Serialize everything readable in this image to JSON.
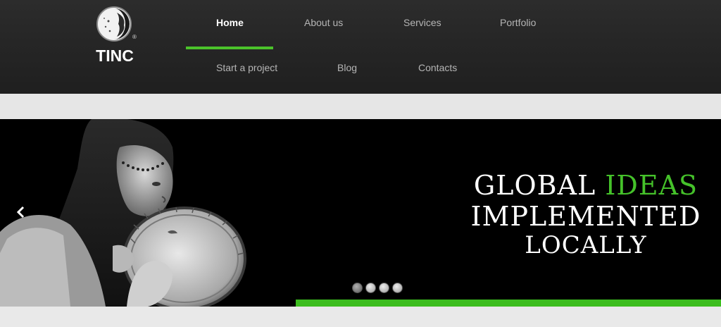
{
  "brand": {
    "name": "TINC",
    "reg_mark": "®"
  },
  "nav": {
    "items": [
      {
        "label": "Home",
        "active": true
      },
      {
        "label": "About us"
      },
      {
        "label": "Services"
      },
      {
        "label": "Portfolio"
      },
      {
        "label": "Start a project"
      },
      {
        "label": "Blog"
      },
      {
        "label": "Contacts"
      }
    ]
  },
  "slider": {
    "headline": {
      "line1_white": "GLOBAL ",
      "line1_green": "IDEAS",
      "line2": "IMPLEMENTED",
      "line3": "LOCALLY"
    },
    "prev_icon": "chevron-left-icon",
    "dots_count": 4,
    "active_dot": 0
  },
  "colors": {
    "accent_green": "#45c22a",
    "header_bg": "#262626"
  }
}
